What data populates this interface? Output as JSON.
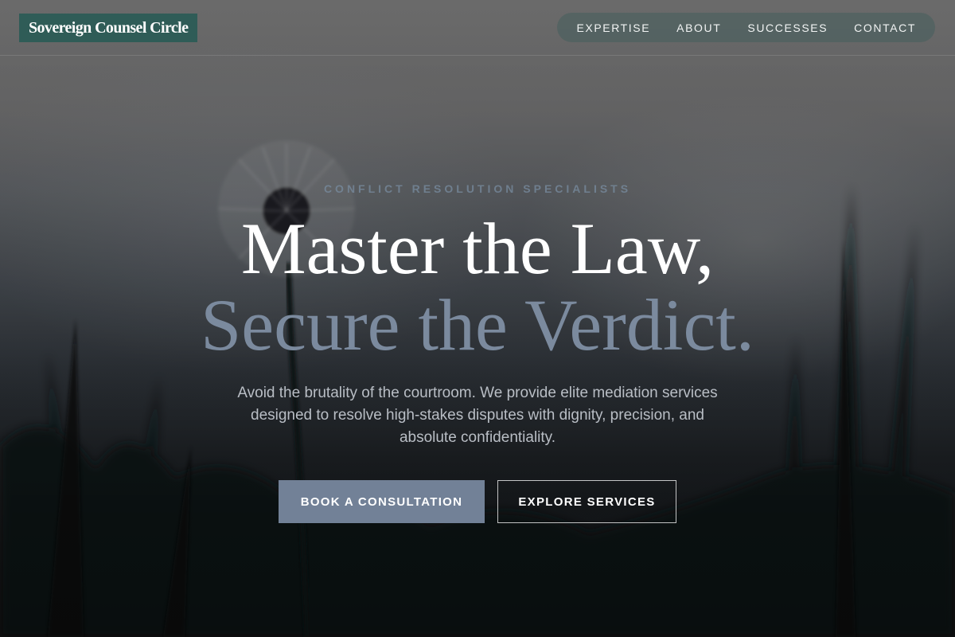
{
  "brand": {
    "name": "Sovereign Counsel Circle",
    "color": "#2f5c57"
  },
  "nav": {
    "items": [
      {
        "label": "EXPERTISE"
      },
      {
        "label": "ABOUT"
      },
      {
        "label": "SUCCESSES"
      },
      {
        "label": "CONTACT"
      }
    ]
  },
  "hero": {
    "eyebrow": "CONFLICT RESOLUTION SPECIALISTS",
    "headline_line1": "Master the Law,",
    "headline_line2": "Secure the Verdict.",
    "subtext": "Avoid the brutality of the courtroom. We provide elite mediation services designed to resolve high-stakes disputes with dignity, precision, and absolute confidentiality.",
    "primary_button": "BOOK A CONSULTATION",
    "secondary_button": "EXPLORE SERVICES",
    "accent_color": "#728197",
    "background_image": "dandelion-silhouette-image"
  }
}
